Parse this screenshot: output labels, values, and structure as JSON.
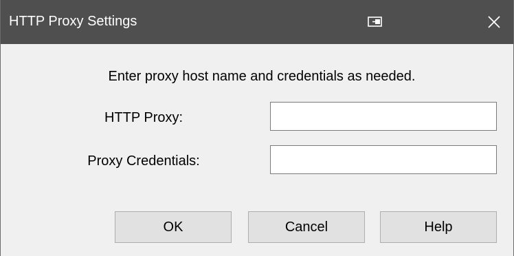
{
  "window": {
    "title": "HTTP Proxy Settings",
    "title_bar_color": "#4f4f4f",
    "body_color": "#f0f0f0",
    "pin_icon": "window-pin-icon",
    "close_icon": "close-icon"
  },
  "dialog": {
    "instruction": "Enter proxy host name and credentials as needed.",
    "fields": {
      "proxy": {
        "label": "HTTP Proxy:",
        "value": "",
        "placeholder": ""
      },
      "credentials": {
        "label": "Proxy Credentials:",
        "value": "",
        "placeholder": ""
      }
    },
    "buttons": {
      "ok": "OK",
      "cancel": "Cancel",
      "help": "Help"
    }
  }
}
